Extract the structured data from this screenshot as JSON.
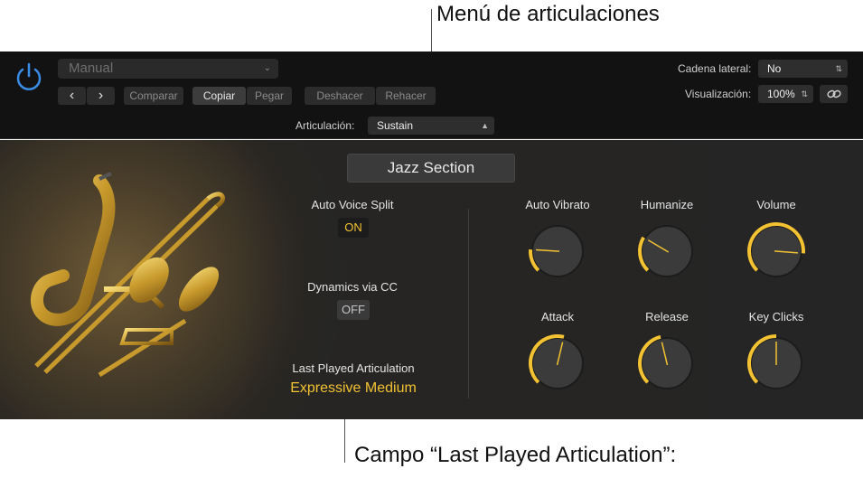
{
  "callouts": {
    "articulation_menu": "Menú de articulaciones",
    "last_played_field": "Campo “Last Played Articulation”:"
  },
  "header": {
    "preset": "Manual",
    "nav_prev": "‹",
    "nav_next": "›",
    "compare": "Comparar",
    "copy": "Copiar",
    "paste": "Pegar",
    "undo": "Deshacer",
    "redo": "Rehacer",
    "articulation_label": "Articulación:",
    "articulation_value": "Sustain",
    "sidechain_label": "Cadena lateral:",
    "sidechain_value": "No",
    "view_label": "Visualización:",
    "view_value": "100%"
  },
  "panel": {
    "title": "Jazz Section",
    "auto_voice_split": {
      "label": "Auto Voice Split",
      "value": "ON"
    },
    "dynamics_via_cc": {
      "label": "Dynamics via CC",
      "value": "OFF"
    },
    "last_played": {
      "label": "Last Played Articulation",
      "value": "Expressive Medium"
    },
    "knobs": [
      {
        "label": "Auto Vibrato",
        "level": 0.18
      },
      {
        "label": "Humanize",
        "level": 0.28
      },
      {
        "label": "Volume",
        "level": 0.85
      },
      {
        "label": "Attack",
        "level": 0.55
      },
      {
        "label": "Release",
        "level": 0.45
      },
      {
        "label": "Key Clicks",
        "level": 0.5
      }
    ]
  },
  "colors": {
    "accent": "#f2c232",
    "header_bg": "#121212",
    "panel_bg": "#252525"
  }
}
